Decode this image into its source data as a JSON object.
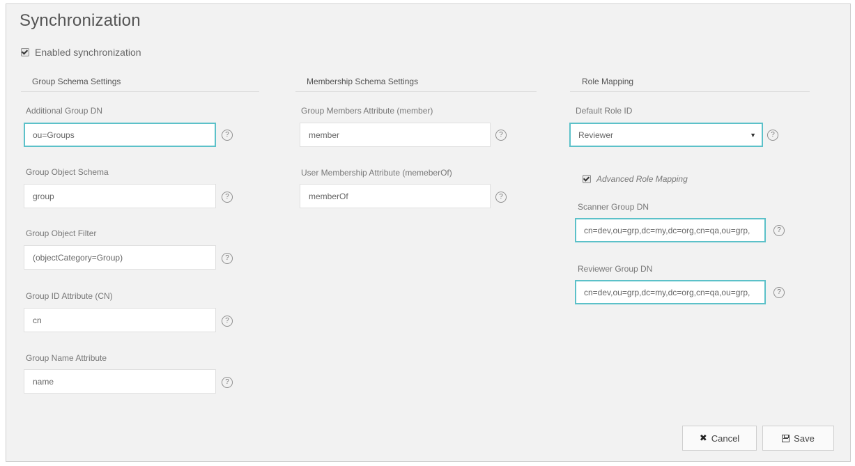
{
  "title": "Synchronization",
  "enabled_label": "Enabled synchronization",
  "columns": {
    "group_schema": "Group Schema Settings",
    "membership_schema": "Membership Schema Settings",
    "role_mapping": "Role Mapping"
  },
  "group_fields": [
    {
      "label": "Additional Group DN",
      "value": "ou=Groups"
    },
    {
      "label": "Group Object Schema",
      "value": "group"
    },
    {
      "label": "Group Object Filter",
      "value": "(objectCategory=Group)"
    },
    {
      "label": "Group ID Attribute (CN)",
      "value": "cn"
    },
    {
      "label": "Group Name Attribute",
      "value": "name"
    }
  ],
  "membership_fields": [
    {
      "label": "Group Members Attribute (member)",
      "value": "member"
    },
    {
      "label": "User Membership Attribute (memeberOf)",
      "value": "memberOf"
    }
  ],
  "role": {
    "default_label": "Default Role ID",
    "default_value": "Reviewer",
    "advanced_label": "Advanced Role Mapping",
    "scanner_label": "Scanner Group DN",
    "scanner_value": "cn=dev,ou=grp,dc=my,dc=org,cn=qa,ou=grp,",
    "reviewer_label": "Reviewer Group DN",
    "reviewer_value": "cn=dev,ou=grp,dc=my,dc=org,cn=qa,ou=grp,"
  },
  "help_glyph": "?",
  "buttons": {
    "cancel": "Cancel",
    "save": "Save"
  },
  "icons": {
    "help": "question-circle-icon",
    "cancel": "x-icon",
    "save": "floppy-disk-icon"
  },
  "colors": {
    "focus_border": "#5cc1c9"
  }
}
